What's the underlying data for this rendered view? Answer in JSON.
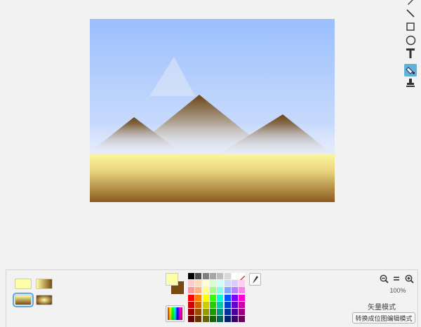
{
  "zoom": {
    "level": "100%"
  },
  "mode": {
    "label": "矢量模式",
    "convert_button": "转换成位图编辑模式"
  },
  "tools": [
    "reshape-icon",
    "line-icon",
    "rectangle-icon",
    "ellipse-icon",
    "text-icon",
    "fill-icon",
    "stamp-icon"
  ],
  "active_tool": "fill-icon",
  "colors": {
    "primary": "#ffffa8",
    "secondary": "#7a4a10",
    "accent": "#5fb3d9"
  },
  "fill_modes": [
    "solid",
    "horizontal-gradient",
    "vertical-gradient",
    "radial-gradient"
  ],
  "palette": [
    [
      "#000000",
      "#4d4d4d",
      "#808080",
      "#a6a6a6",
      "#bfbfbf",
      "#d9d9d9",
      "#ffffff",
      "none"
    ],
    [
      "#ffcccc",
      "#ffdcb8",
      "#ffffcc",
      "#d4ffcc",
      "#ccfff5",
      "#ccdcff",
      "#dcccff",
      "#ffccf5"
    ],
    [
      "#ff9999",
      "#ffb380",
      "#ffff80",
      "#9fff80",
      "#80ffea",
      "#80a8ff",
      "#b380ff",
      "#ff80e6"
    ],
    [
      "#ff0000",
      "#ff8000",
      "#ffff00",
      "#33ff00",
      "#00ffd5",
      "#0055ff",
      "#8000ff",
      "#ff00d4"
    ],
    [
      "#cc0000",
      "#cc6600",
      "#cccc00",
      "#29cc00",
      "#00ccaa",
      "#0044cc",
      "#6600cc",
      "#cc00aa"
    ],
    [
      "#990000",
      "#994c00",
      "#999900",
      "#1f9900",
      "#009980",
      "#003399",
      "#4c0099",
      "#990080"
    ],
    [
      "#660000",
      "#663300",
      "#666600",
      "#146600",
      "#006655",
      "#002266",
      "#330066",
      "#660055"
    ]
  ]
}
